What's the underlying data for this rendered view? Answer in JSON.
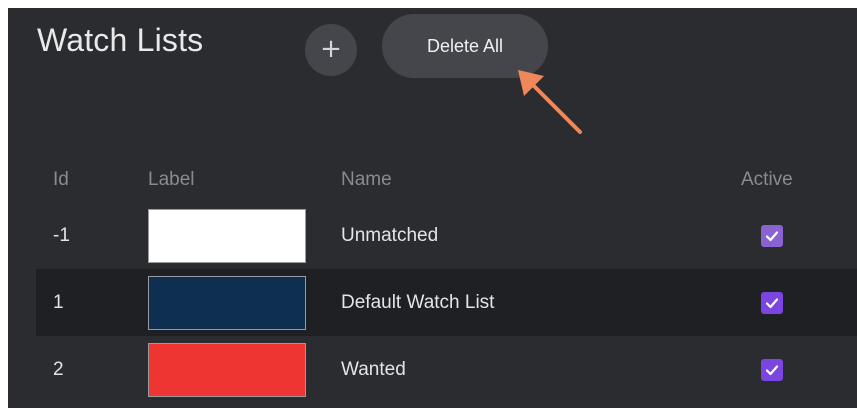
{
  "header": {
    "title": "Watch Lists",
    "add_label": "+",
    "delete_all_label": "Delete All"
  },
  "table": {
    "columns": [
      "Id",
      "Label",
      "Name",
      "Active"
    ],
    "rows": [
      {
        "id": "-1",
        "label_color": "#ffffff",
        "name": "Unmatched",
        "active": true,
        "active_color": "#8a63d2"
      },
      {
        "id": "1",
        "label_color": "#0f2f50",
        "name": "Default Watch List",
        "active": true,
        "active_color": "#7b45e0"
      },
      {
        "id": "2",
        "label_color": "#ef3532",
        "name": "Wanted",
        "active": true,
        "active_color": "#7b45e0"
      }
    ]
  },
  "annotation": {
    "arrow_color": "#f0875a",
    "target": "delete-all-button"
  }
}
